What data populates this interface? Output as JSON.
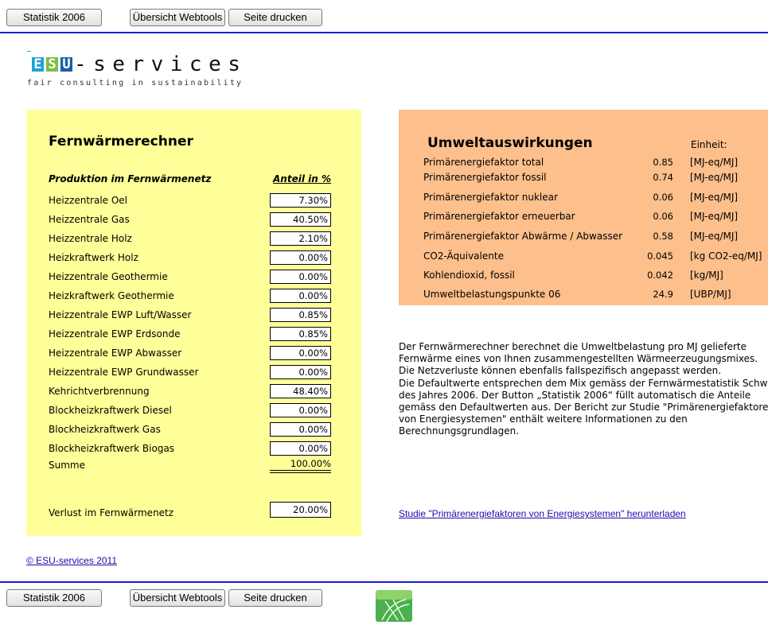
{
  "toolbar": {
    "statistik_label": "Statistik 2006",
    "webtools_label": "Übersicht Webtools",
    "print_label": "Seite drucken"
  },
  "logo": {
    "letters": [
      "E",
      "S",
      "U"
    ],
    "word": "-services",
    "tagline": "fair consulting in sustainability",
    "colors": {
      "E": "#1ea0d8",
      "S": "#7ac142",
      "U": "#1a5ea8"
    }
  },
  "calculator": {
    "title": "Fernwärmerechner",
    "col_label": "Produktion im Fernwärmenetz",
    "col_value": "Anteil in %",
    "rows": [
      {
        "label": "Heizzentrale Oel",
        "value": "7.30%"
      },
      {
        "label": "Heizzentrale Gas",
        "value": "40.50%"
      },
      {
        "label": "Heizzentrale Holz",
        "value": "2.10%"
      },
      {
        "label": "Heizkraftwerk Holz",
        "value": "0.00%"
      },
      {
        "label": "Heizzentrale Geothermie",
        "value": "0.00%"
      },
      {
        "label": "Heizkraftwerk Geothermie",
        "value": "0.00%"
      },
      {
        "label": "Heizzentrale EWP Luft/Wasser",
        "value": "0.85%"
      },
      {
        "label": "Heizzentrale EWP Erdsonde",
        "value": "0.85%"
      },
      {
        "label": "Heizzentrale EWP Abwasser",
        "value": "0.00%"
      },
      {
        "label": "Heizzentrale EWP Grundwasser",
        "value": "0.00%"
      },
      {
        "label": "Kehrichtverbrennung",
        "value": "48.40%"
      },
      {
        "label": "Blockheizkraftwerk Diesel",
        "value": "0.00%"
      },
      {
        "label": "Blockheizkraftwerk Gas",
        "value": "0.00%"
      },
      {
        "label": "Blockheizkraftwerk Biogas",
        "value": "0.00%"
      }
    ],
    "sum_label": "Summe",
    "sum_value": "100.00%",
    "loss_label": "Verlust im Fernwärmenetz",
    "loss_value": "20.00%"
  },
  "impacts": {
    "title": "Umweltauswirkungen",
    "unit_header": "Einheit:",
    "rows": [
      {
        "label": "Primärenergiefaktor total",
        "value": "0.85",
        "unit": "[MJ-eq/MJ]"
      },
      {
        "label": "Primärenergiefaktor fossil",
        "value": "0.74",
        "unit": "[MJ-eq/MJ]"
      },
      {
        "label": "Primärenergiefaktor nuklear",
        "value": "0.06",
        "unit": "[MJ-eq/MJ]"
      },
      {
        "label": "Primärenergiefaktor erneuerbar",
        "value": "0.06",
        "unit": "[MJ-eq/MJ]"
      },
      {
        "label": "Primärenergiefaktor Abwärme / Abwasser",
        "value": "0.58",
        "unit": "[MJ-eq/MJ]"
      },
      {
        "label": "CO2-Äquivalente",
        "value": "0.045",
        "unit": "[kg CO2-eq/MJ]"
      },
      {
        "label": "Kohlendioxid, fossil",
        "value": "0.042",
        "unit": "[kg/MJ]"
      },
      {
        "label": "Umweltbelastungspunkte 06",
        "value": "24.9",
        "unit": "[UBP/MJ]"
      }
    ]
  },
  "description": {
    "lines": [
      "Der Fernwärmerechner berechnet die Umweltbelastung pro MJ gelieferte",
      "Fernwärme eines von Ihnen zusammengestellten Wärmeerzeugungsmixes.",
      "Die Netzverluste können ebenfalls fallspezifisch angepasst werden.",
      "Die Defaultwerte entsprechen dem Mix gemäss der Fernwärmestatistik Schweiz",
      "des Jahres 2006. Der Button „Statistik 2006“ füllt automatisch die Anteile",
      "gemäss den Defaultwerten aus. Der Bericht zur Studie \"Primärenergiefaktoren",
      "von Energiesystemen\" enthält weitere Informationen zu den",
      "Berechnungsgrundlagen."
    ]
  },
  "download_link": "Studie \"Primärenergiefaktoren von Energiesystemen\" herunterladen",
  "copyright": "© ESU-services 2011"
}
